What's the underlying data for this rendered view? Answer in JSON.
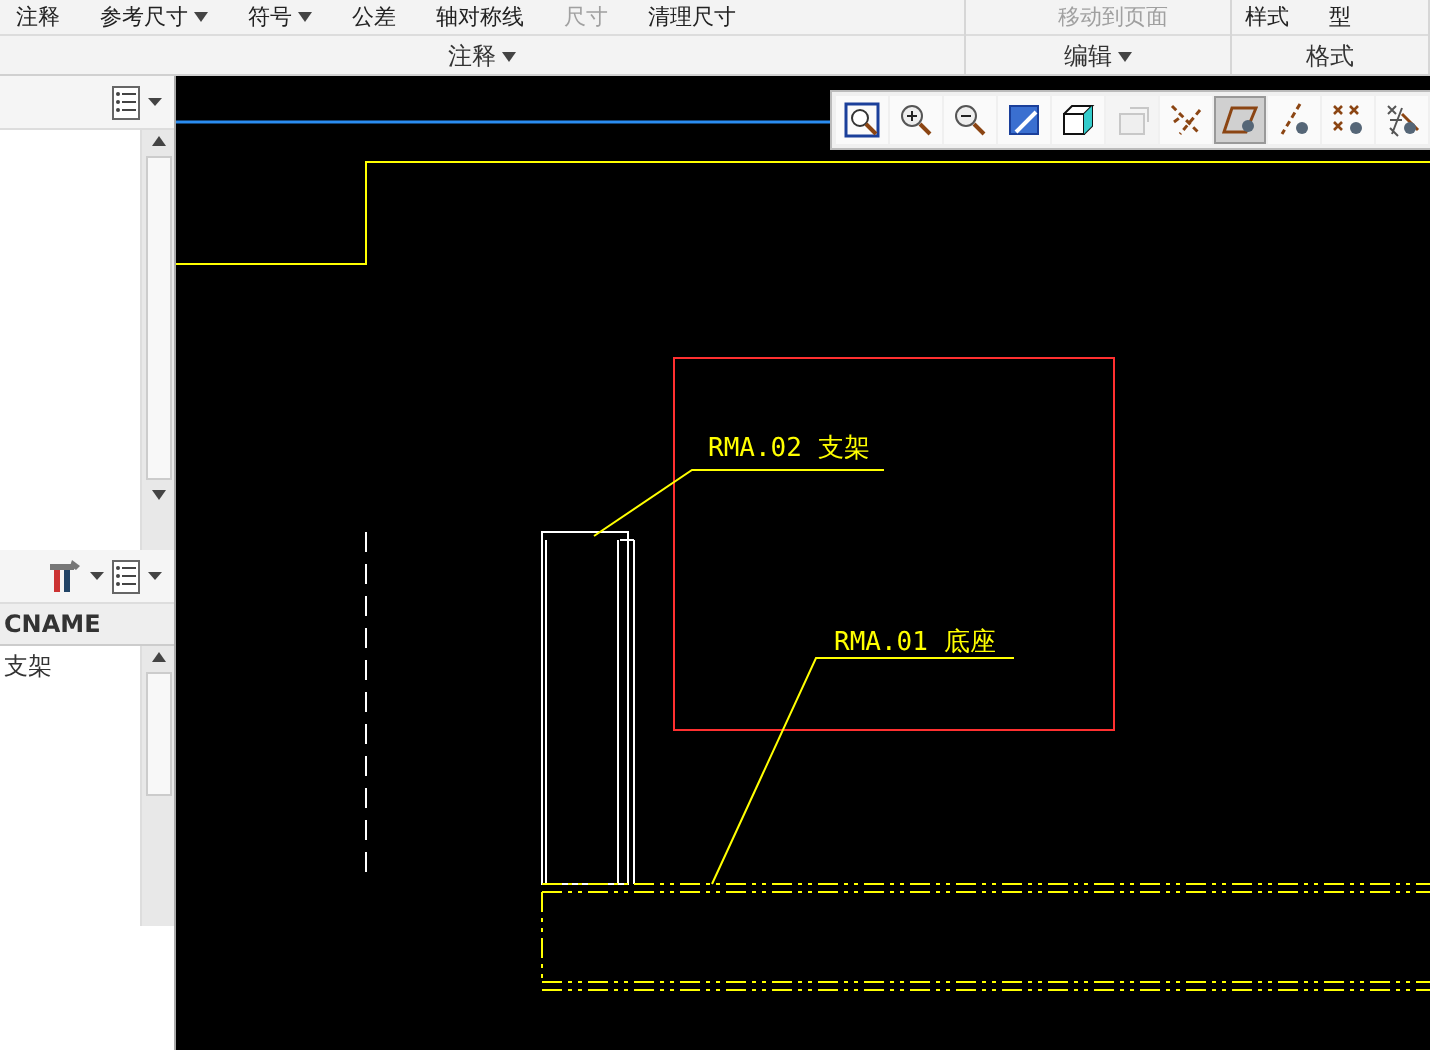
{
  "ribbon": {
    "groups": [
      {
        "label": "注释",
        "caret": true,
        "commands": [
          {
            "label": "注释",
            "caret": false,
            "disabled": false
          },
          {
            "label": "参考尺寸",
            "caret": true,
            "disabled": false
          },
          {
            "label": "符号",
            "caret": true,
            "disabled": false
          },
          {
            "label": "公差",
            "caret": false,
            "disabled": false
          },
          {
            "label": "轴对称线",
            "caret": false,
            "disabled": false
          },
          {
            "label": "尺寸",
            "caret": false,
            "disabled": true
          },
          {
            "label": "清理尺寸",
            "caret": false,
            "disabled": false
          }
        ]
      },
      {
        "label": "编辑",
        "caret": true,
        "commands": [
          {
            "label": "移动到页面",
            "caret": false,
            "disabled": true
          }
        ]
      },
      {
        "label": "格式",
        "caret": false,
        "commands": [
          {
            "label": "样式",
            "caret": false,
            "disabled": false
          },
          {
            "label": "型",
            "caret": false,
            "disabled": false
          }
        ]
      }
    ]
  },
  "model_tree": {
    "table": {
      "columns": [
        "CNAME"
      ],
      "rows": [
        [
          "支架"
        ]
      ]
    }
  },
  "view_toolbar": [
    {
      "kind": "zoom-fit",
      "selected": false,
      "disabled": false
    },
    {
      "kind": "zoom-in",
      "selected": false,
      "disabled": false
    },
    {
      "kind": "zoom-out",
      "selected": false,
      "disabled": false
    },
    {
      "kind": "repaint",
      "selected": false,
      "disabled": false
    },
    {
      "kind": "view",
      "selected": false,
      "disabled": false
    },
    {
      "kind": "annotation",
      "selected": false,
      "disabled": true
    },
    {
      "kind": "datum-axes",
      "selected": false,
      "disabled": false
    },
    {
      "kind": "datum-planes",
      "selected": true,
      "disabled": false
    },
    {
      "kind": "datum-axis",
      "selected": false,
      "disabled": false
    },
    {
      "kind": "datum-points",
      "selected": false,
      "disabled": false
    },
    {
      "kind": "coord-sys",
      "selected": false,
      "disabled": false
    }
  ],
  "drawing": {
    "balloons": [
      {
        "label": "RMA.02 支架"
      },
      {
        "label": "RMA.01 底座"
      }
    ]
  }
}
